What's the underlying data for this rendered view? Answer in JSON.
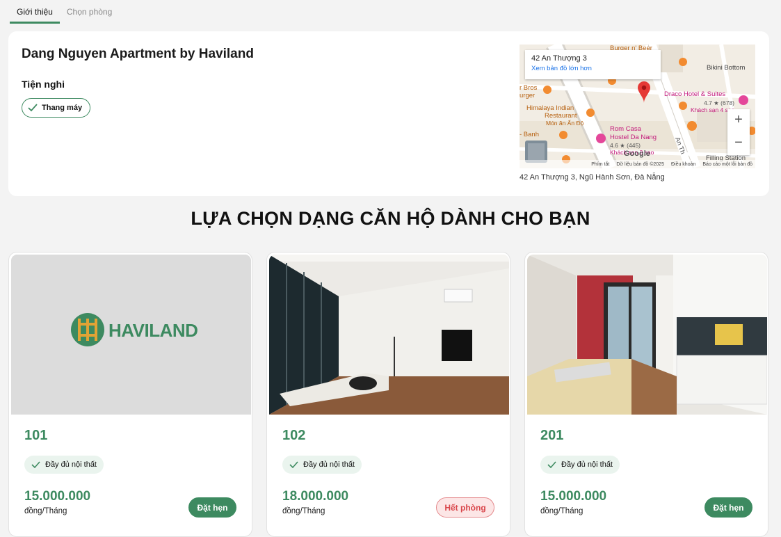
{
  "tabs": [
    {
      "label": "Giới thiệu",
      "active": true
    },
    {
      "label": "Chọn phòng",
      "active": false
    }
  ],
  "property": {
    "name": "Dang Nguyen Apartment by Haviland",
    "amenities_title": "Tiện nghi",
    "amenities": [
      "Thang máy"
    ],
    "address": "42 An Thượng 3, Ngũ Hành Sơn, Đà Nẵng"
  },
  "map": {
    "card_address": "42 An Thượng 3",
    "card_link": "Xem bản đồ lớn hơn",
    "labels": {
      "burger": "Burger n' Beer",
      "bikini": "Bikini Bottom",
      "bros": "r Bros",
      "burger2": "urger",
      "draco": "Draco Hotel & Suites",
      "draco_rating": "4.7 ★ (678)",
      "draco_sub": "Khách sạn 4 sao",
      "himalaya": "Himalaya Indian",
      "restaurant": "Restaurant",
      "monan": "Món ăn Ấn Độ",
      "banh": "- Banh",
      "romcasa": "Rom Casa",
      "hostel": "Hostel Da Nang",
      "hostel_rating": "4.6 ★ (445)",
      "hostel_sub": "Khách sạn 2 sao",
      "filling": "Filling Station",
      "street_an_thuong": "An Th",
      "google": "Google"
    },
    "footer": [
      "Phím tắt",
      "Dữ liệu bản đồ ©2025",
      "Điều khoản",
      "Báo cáo một lỗi bản đồ"
    ],
    "zoom_in": "+",
    "zoom_out": "−",
    "colors": {
      "pin": "#e53935",
      "road": "#ffffff",
      "poi_orange": "#f28b30",
      "poi_pink": "#e4479a"
    }
  },
  "section_title": "LỰA CHỌN DẠNG CĂN HỘ DÀNH CHO BẠN",
  "rooms": [
    {
      "number": "101",
      "furnish": "Đầy đủ nội thất",
      "price": "15.000.000",
      "unit": "đồng/Tháng",
      "button": "Đặt hẹn",
      "status": "available",
      "photo": "haviland-logo",
      "logo_text": "HAVILAND"
    },
    {
      "number": "102",
      "furnish": "Đầy đủ nội thất",
      "price": "18.000.000",
      "unit": "đồng/Tháng",
      "button": "Hết phòng",
      "status": "sold-out",
      "photo": "living-room"
    },
    {
      "number": "201",
      "furnish": "Đầy đủ nội thất",
      "price": "15.000.000",
      "unit": "đồng/Tháng",
      "button": "Đặt hẹn",
      "status": "available",
      "photo": "studio-kitchen"
    }
  ],
  "theme": {
    "accent": "#3d8a60",
    "danger": "#d9464b",
    "background": "#f3f3f3"
  }
}
